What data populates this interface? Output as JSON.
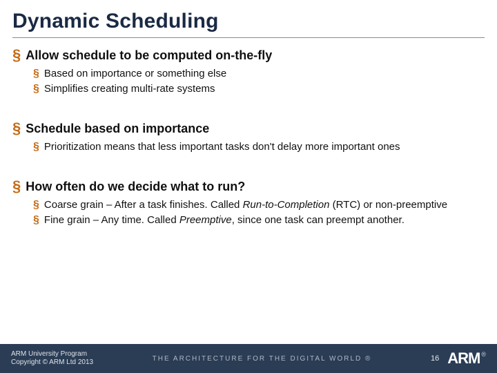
{
  "title": "Dynamic Scheduling",
  "sections": [
    {
      "lead": "Allow schedule to be computed on-the-fly",
      "subs": [
        {
          "html": "Based on importance or something else"
        },
        {
          "html": "Simplifies creating multi-rate systems"
        }
      ]
    },
    {
      "lead": "Schedule based on importance",
      "subs": [
        {
          "html": "Prioritization means that less important tasks don't delay more important ones"
        }
      ]
    },
    {
      "lead": "How often do we decide what to run?",
      "subs": [
        {
          "html": "Coarse grain – After a task finishes. Called <em>Run-to-Completion</em> (RTC) or non-preemptive"
        },
        {
          "html": "Fine grain – Any time. Called <em>Preemptive</em>, since one task can preempt another."
        }
      ]
    }
  ],
  "footer": {
    "line1": "ARM University Program",
    "line2": "Copyright © ARM Ltd 2013",
    "tagline": "THE ARCHITECTURE FOR THE DIGITAL WORLD ®",
    "page": "16",
    "logo": "ARM",
    "reg": "®"
  }
}
